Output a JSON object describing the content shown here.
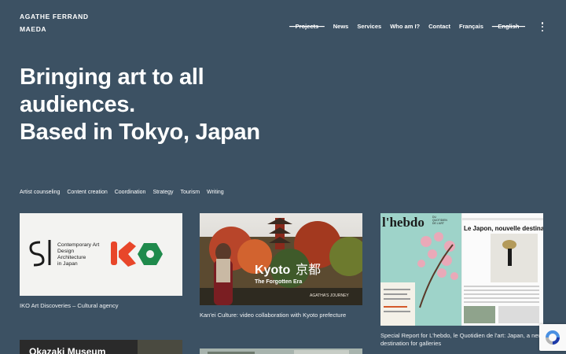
{
  "brand": {
    "line1": "AGATHE FERRAND",
    "line2": "MAEDA"
  },
  "nav": [
    {
      "label": "Projects",
      "struck": true
    },
    {
      "label": "News",
      "struck": false
    },
    {
      "label": "Services",
      "struck": false
    },
    {
      "label": "Who am I?",
      "struck": false
    },
    {
      "label": "Contact",
      "struck": false
    },
    {
      "label": "Français",
      "struck": false
    },
    {
      "label": "English",
      "struck": true
    }
  ],
  "hero": {
    "line1": "Bringing art to all",
    "line2": "audiences.",
    "line3": "Based in Tokyo, Japan"
  },
  "tags": [
    "Artist counseling",
    "Content creation",
    "Coordination",
    "Strategy",
    "Tourism",
    "Writing"
  ],
  "cards": [
    {
      "caption": "IKO Art Discoveries – Cultural agency",
      "logo_text": [
        "Contemporary Art",
        "Design",
        "Architecture",
        "in Japan"
      ]
    },
    {
      "caption": "Kan'ei Culture: video collaboration with Kyoto prefecture",
      "title": "Kyoto",
      "title_jp": "京都",
      "subtitle": "The Forgotten Era",
      "credit": "AGATHA'S JOURNEY"
    },
    {
      "caption": "Special Report for L'hebdo, le Quotidien de l'art: Japan, a new destination for galleries",
      "masthead": "l'hebdo",
      "masthead_sub": [
        "DU",
        "QUOTIDIEN",
        "DE L'ART"
      ],
      "headline": "Le Japon, nouvelle destination des galeries"
    },
    {
      "caption": "",
      "title": "Okazaki Museum"
    },
    {
      "caption": ""
    }
  ],
  "colors": {
    "background": "#3c5163",
    "text": "#ffffff",
    "iko_red": "#e8462a",
    "iko_green": "#1f8a4c"
  }
}
